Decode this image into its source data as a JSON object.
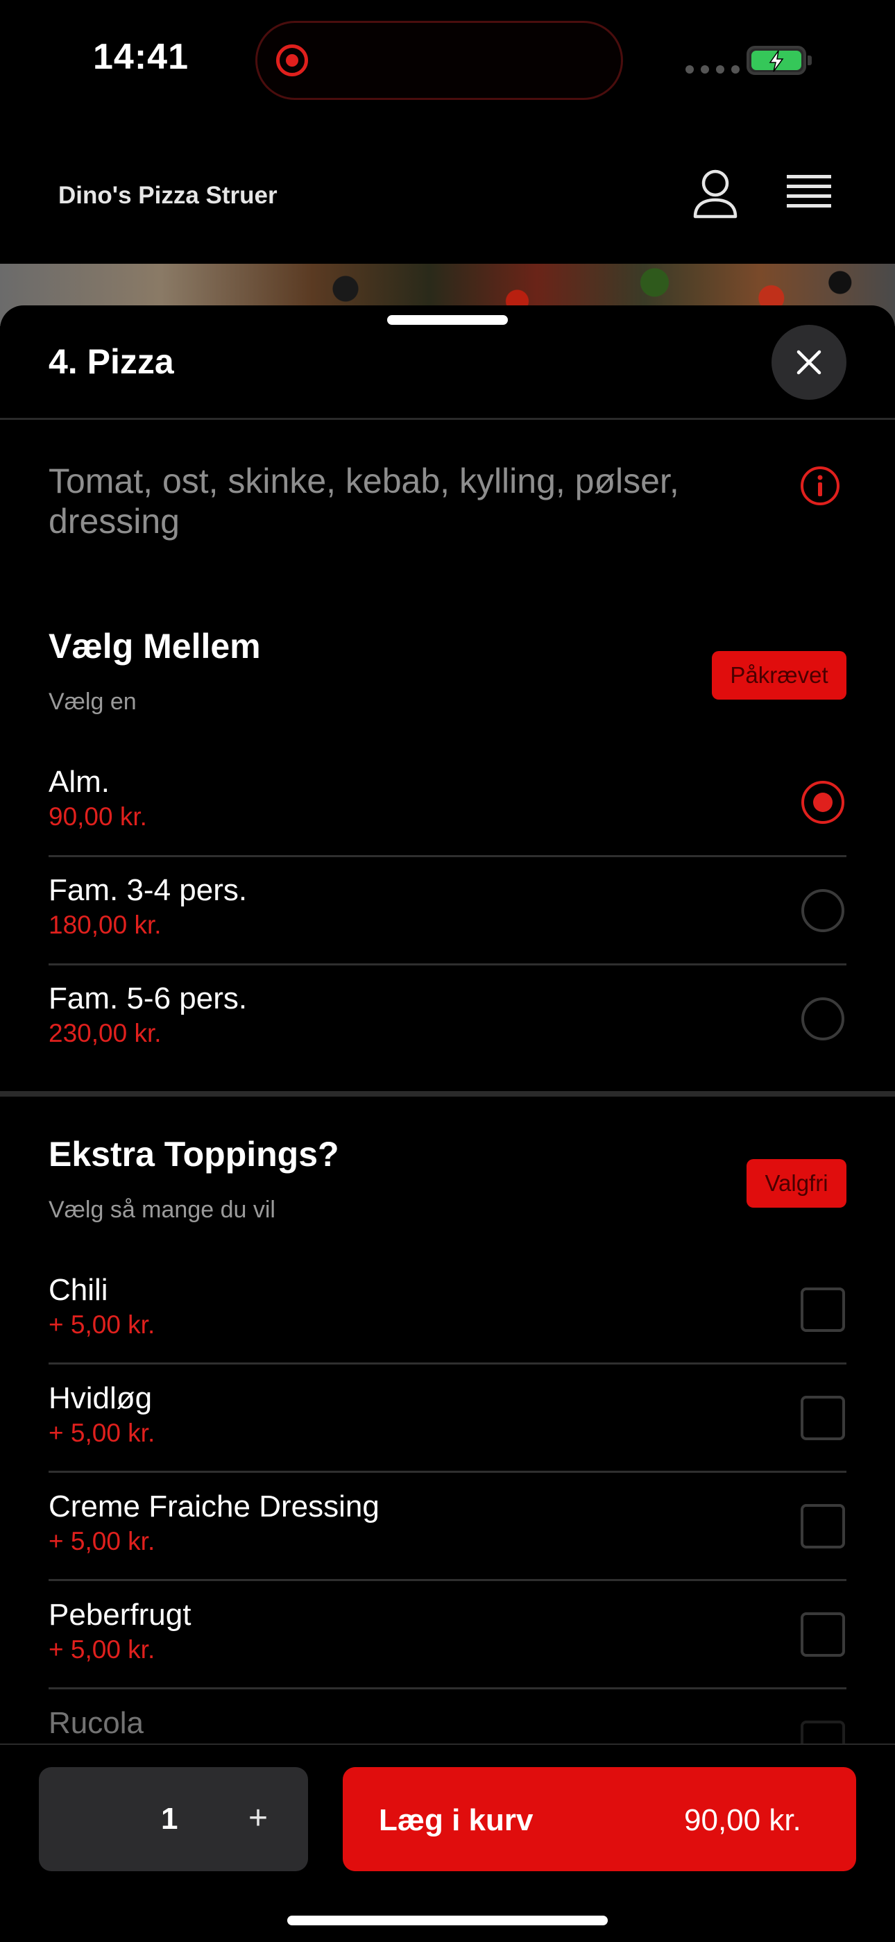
{
  "status_bar": {
    "time": "14:41"
  },
  "header": {
    "brand": "Dino's Pizza Struer"
  },
  "sheet": {
    "title": "4. Pizza",
    "description": "Tomat, ost, skinke, kebab, kylling, pølser, dressing"
  },
  "size_section": {
    "title": "Vælg Mellem",
    "subtitle": "Vælg en",
    "badge": "Påkrævet",
    "options": [
      {
        "name": "Alm.",
        "price": "90,00 kr.",
        "selected": true
      },
      {
        "name": "Fam. 3-4 pers.",
        "price": "180,00 kr.",
        "selected": false
      },
      {
        "name": "Fam. 5-6 pers.",
        "price": "230,00 kr.",
        "selected": false
      }
    ]
  },
  "toppings_section": {
    "title": "Ekstra Toppings?",
    "subtitle": "Vælg så mange du vil",
    "badge": "Valgfri",
    "options": [
      {
        "name": "Chili",
        "price": "+ 5,00 kr."
      },
      {
        "name": "Hvidløg",
        "price": "+ 5,00 kr."
      },
      {
        "name": "Creme Fraiche Dressing",
        "price": "+ 5,00 kr."
      },
      {
        "name": "Peberfrugt",
        "price": "+ 5,00 kr."
      },
      {
        "name": "Rucola",
        "price": ""
      }
    ]
  },
  "bottom_bar": {
    "quantity": "1",
    "plus_label": "+",
    "add_to_cart_label": "Læg i kurv",
    "total": "90,00 kr."
  },
  "colors": {
    "accent": "#e00d0d",
    "price": "#e0201d",
    "background": "#000000"
  }
}
